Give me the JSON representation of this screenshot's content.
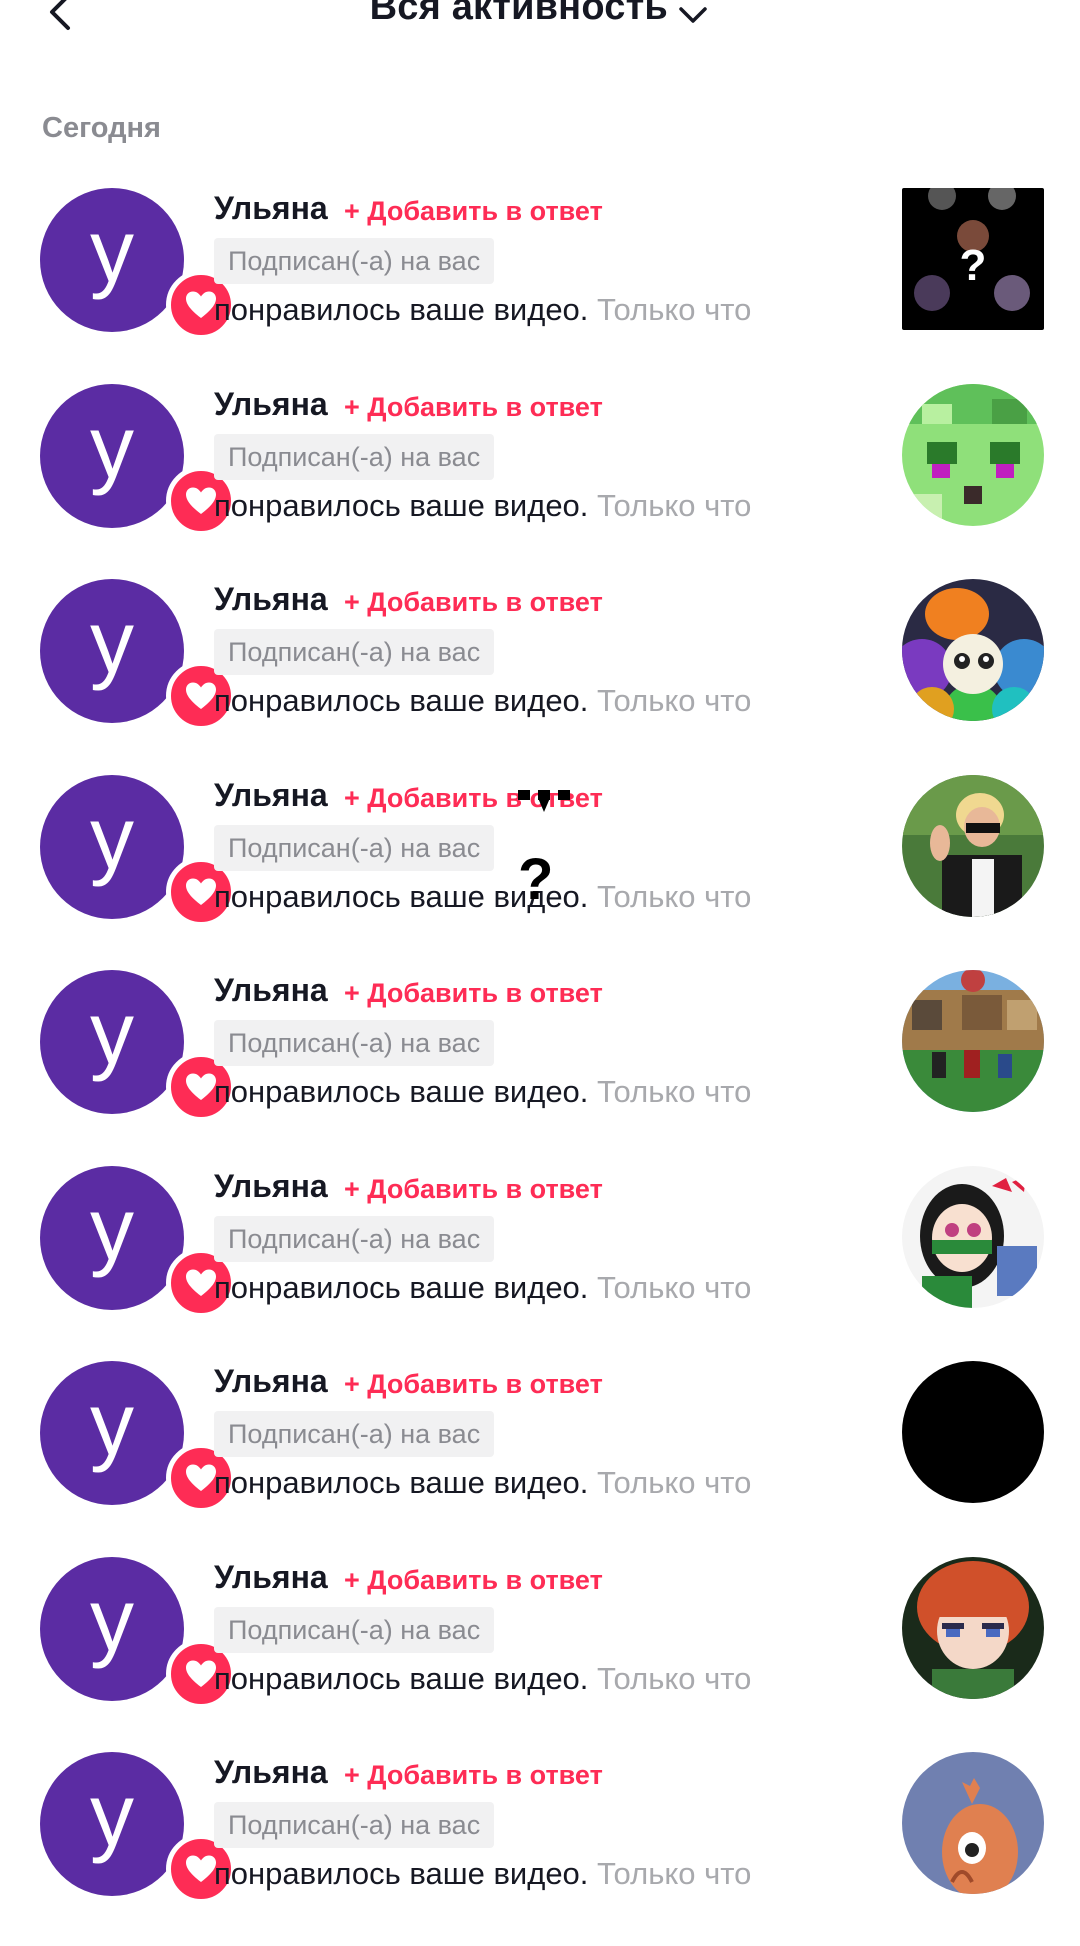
{
  "header": {
    "title": "Вся активность",
    "back_icon": "chevron-left-icon",
    "dropdown_icon": "chevron-down-icon"
  },
  "section": {
    "label": "Сегодня"
  },
  "colors": {
    "accent": "#fe2c55",
    "avatar_bg": "#5b2ca3",
    "muted_text": "#8a8b91",
    "badge_bg": "#f1f1f2"
  },
  "notifications": [
    {
      "name": "Ульяна",
      "add_reply": "+ Добавить в ответ",
      "badge": "Подписан(-а) на вас",
      "message": "понравилось ваше видео.",
      "time": "Только что",
      "avatar_letter": "у",
      "thumb": "collage"
    },
    {
      "name": "Ульяна",
      "add_reply": "+ Добавить в ответ",
      "badge": "Подписан(-а) на вас",
      "message": "понравилось ваше видео.",
      "time": "Только что",
      "avatar_letter": "у",
      "thumb": "pixel-face"
    },
    {
      "name": "Ульяна",
      "add_reply": "+ Добавить в ответ",
      "badge": "Подписан(-а) на вас",
      "message": "понравилось ваше видео.",
      "time": "Только что",
      "avatar_letter": "у",
      "thumb": "flower"
    },
    {
      "name": "Ульяна",
      "add_reply": "+ Добавить в ответ",
      "badge": "Подписан(-а) на вас",
      "message": "понравилось ваше видео.",
      "time": "Только что",
      "avatar_letter": "у",
      "thumb": "person"
    },
    {
      "name": "Ульяна",
      "add_reply": "+ Добавить в ответ",
      "badge": "Подписан(-а) на вас",
      "message": "понравилось ваше видео.",
      "time": "Только что",
      "avatar_letter": "у",
      "thumb": "game"
    },
    {
      "name": "Ульяна",
      "add_reply": "+ Добавить в ответ",
      "badge": "Подписан(-а) на вас",
      "message": "понравилось ваше видео.",
      "time": "Только что",
      "avatar_letter": "у",
      "thumb": "anime"
    },
    {
      "name": "Ульяна",
      "add_reply": "+ Добавить в ответ",
      "badge": "Подписан(-а) на вас",
      "message": "понравилось ваше видео.",
      "time": "Только что",
      "avatar_letter": "у",
      "thumb": "black"
    },
    {
      "name": "Ульяна",
      "add_reply": "+ Добавить в ответ",
      "badge": "Подписан(-а) на вас",
      "message": "понравилось ваше видео.",
      "time": "Только что",
      "avatar_letter": "у",
      "thumb": "figure"
    },
    {
      "name": "Ульяна",
      "add_reply": "+ Добавить в ответ",
      "badge": "Подписан(-а) на вас",
      "message": "понравилось ваше видео.",
      "time": "Только что",
      "avatar_letter": "у",
      "thumb": "creature"
    }
  ],
  "overlay": {
    "glyph": "?"
  }
}
